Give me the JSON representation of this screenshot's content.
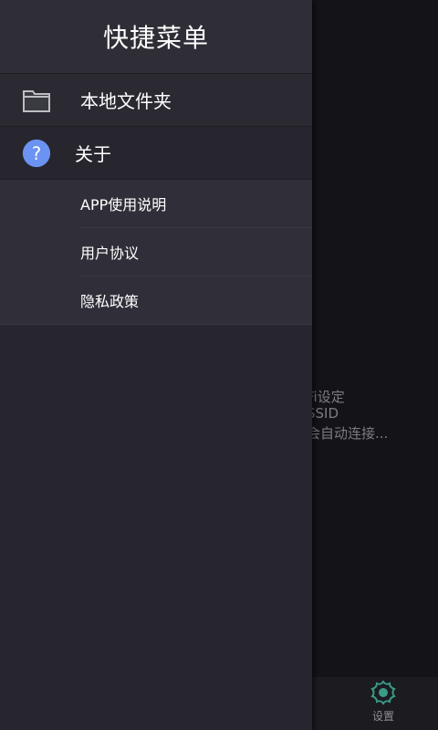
{
  "drawer": {
    "title": "快捷菜单",
    "items": [
      {
        "label": "本地文件夹",
        "icon": "folder-icon"
      },
      {
        "label": "关于",
        "icon": "help-icon"
      }
    ],
    "about_submenu": [
      {
        "label": "APP使用说明"
      },
      {
        "label": "用户协议"
      },
      {
        "label": "隐私政策"
      }
    ]
  },
  "background": {
    "lines": [
      "Fi设定",
      "SSID",
      "会自动连接..."
    ],
    "bottom_tab": {
      "label": "设置",
      "icon": "gear-icon"
    }
  },
  "colors": {
    "drawer_bg": "#27262e",
    "help_accent": "#6b93f2",
    "gear_accent": "#3a9b86"
  }
}
